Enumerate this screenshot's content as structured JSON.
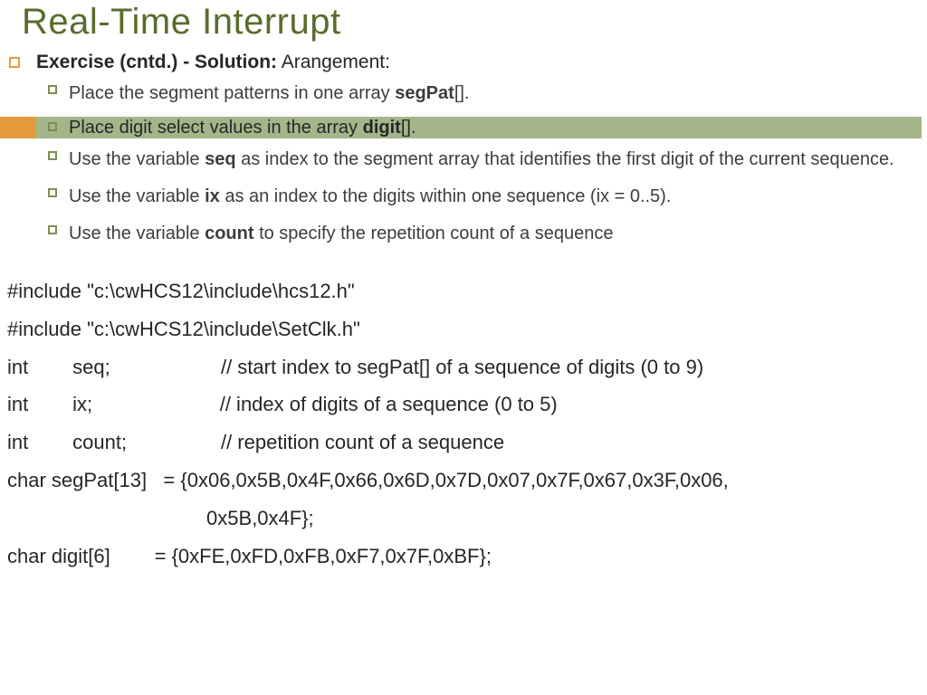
{
  "title": "Real-Time Interrupt",
  "exercise_label": "Exercise (cntd.) - Solution:",
  "exercise_tail": " Arangement:",
  "bullets": [
    {
      "pre": "Place the segment patterns in one array ",
      "bold": "segPat",
      "post": "[]."
    },
    {
      "pre": "Place digit select values in the array ",
      "bold": "digit",
      "post": "[].",
      "highlighted": true
    },
    {
      "pre": "Use the variable ",
      "bold": "seq",
      "post": " as index to the segment array that identifies the first digit of the current sequence."
    },
    {
      "pre": "Use the variable ",
      "bold": "ix",
      "post": " as an index to the digits within one sequence (ix = 0..5)."
    },
    {
      "pre": "Use the variable ",
      "bold": "count",
      "post": " to specify the repetition count of a sequence"
    }
  ],
  "code": {
    "l1": "#include \"c:\\cwHCS12\\include\\hcs12.h\"",
    "l2": "#include \"c:\\cwHCS12\\include\\SetClk.h\"",
    "l3": "int        seq;                    // start index to segPat[] of a sequence of digits (0 to 9)",
    "l4": "int        ix;                       // index of digits of a sequence (0 to 5)",
    "l5": "int        count;                 // repetition count of a sequence",
    "l6": "char segPat[13]   = {0x06,0x5B,0x4F,0x66,0x6D,0x7D,0x07,0x7F,0x67,0x3F,0x06,",
    "l7": "                                    0x5B,0x4F};",
    "l8": "char digit[6]        = {0xFE,0xFD,0xFB,0xF7,0x7F,0xBF};"
  }
}
